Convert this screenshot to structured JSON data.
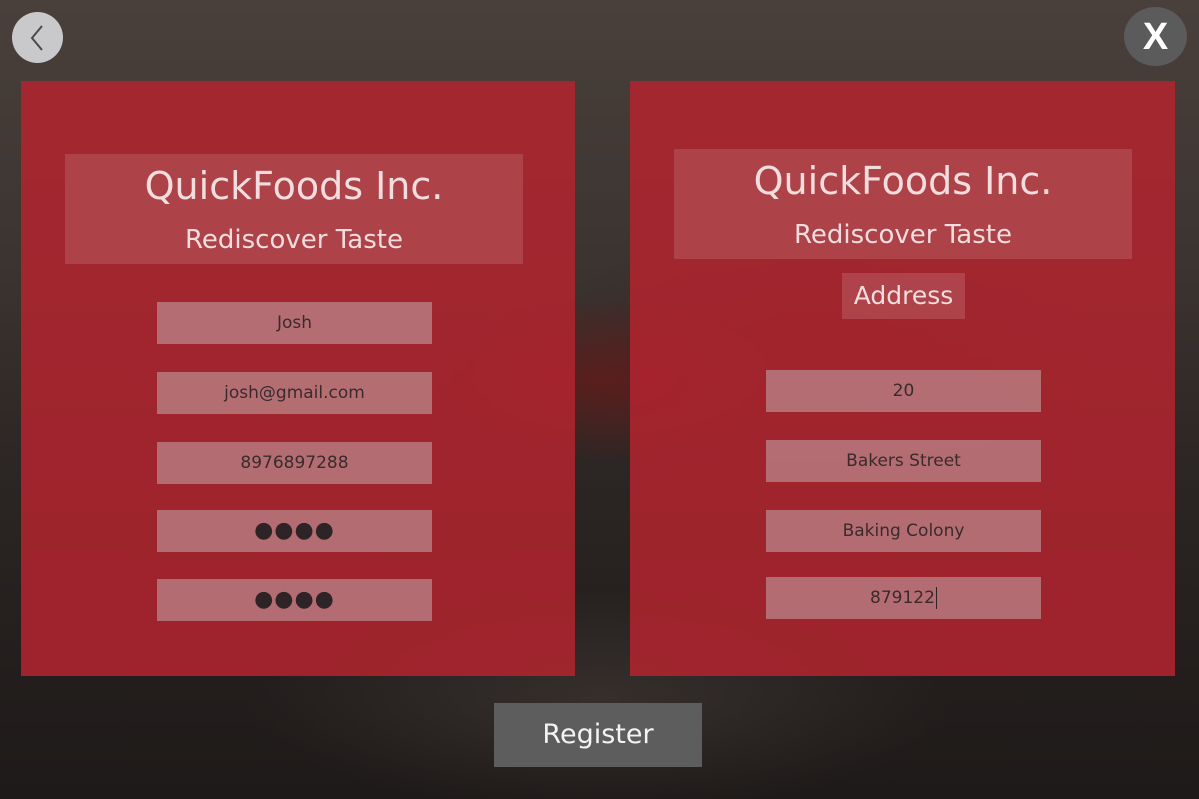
{
  "nav": {
    "back_icon": "chevron-left-icon",
    "close_label": "X"
  },
  "left_panel": {
    "brand_title": "QuickFoods Inc.",
    "brand_subtitle": "Rediscover Taste",
    "fields": {
      "name": "Josh",
      "email": "josh@gmail.com",
      "phone": "8976897288",
      "password": "●●●●",
      "confirm_password": "●●●●"
    }
  },
  "right_panel": {
    "brand_title": "QuickFoods Inc.",
    "brand_subtitle": "Rediscover Taste",
    "section_label": "Address",
    "fields": {
      "house_number": "20",
      "street": "Bakers Street",
      "locality": "Baking Colony",
      "pincode": "879122"
    }
  },
  "actions": {
    "register_label": "Register"
  },
  "colors": {
    "panel": "#b2242e",
    "button": "#5d5d5d",
    "back_button": "#c9c9cc",
    "close_button": "#5b5b5b"
  }
}
